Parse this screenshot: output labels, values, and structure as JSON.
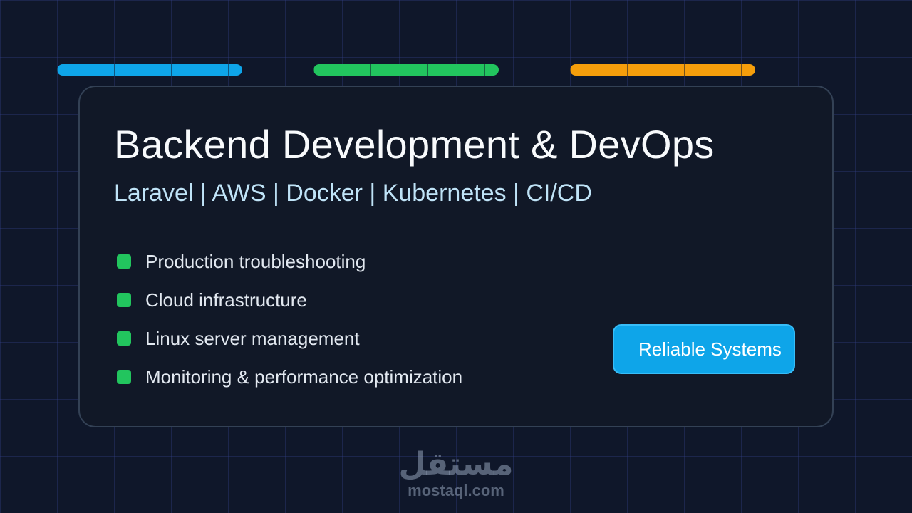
{
  "colors": {
    "background": "#0f172a",
    "card": "#111827",
    "card_border": "#334155",
    "title": "#f8fafc",
    "tech_stack": "#bfe3f7",
    "bullet": "#22c55e",
    "accent_blue": "#0ea5e9",
    "accent_green": "#22c55e",
    "accent_orange": "#f59e0b"
  },
  "card": {
    "title": "Backend Development & DevOps",
    "tech_stack": "Laravel  |  AWS  |  Docker  |  Kubernetes  |  CI/CD",
    "features": [
      "Production troubleshooting",
      "Cloud infrastructure",
      "Linux server management",
      "Monitoring & performance optimization"
    ],
    "badge_label": "Reliable Systems"
  },
  "watermark": {
    "logo_text": "مستقل",
    "url": "mostaql.com"
  }
}
